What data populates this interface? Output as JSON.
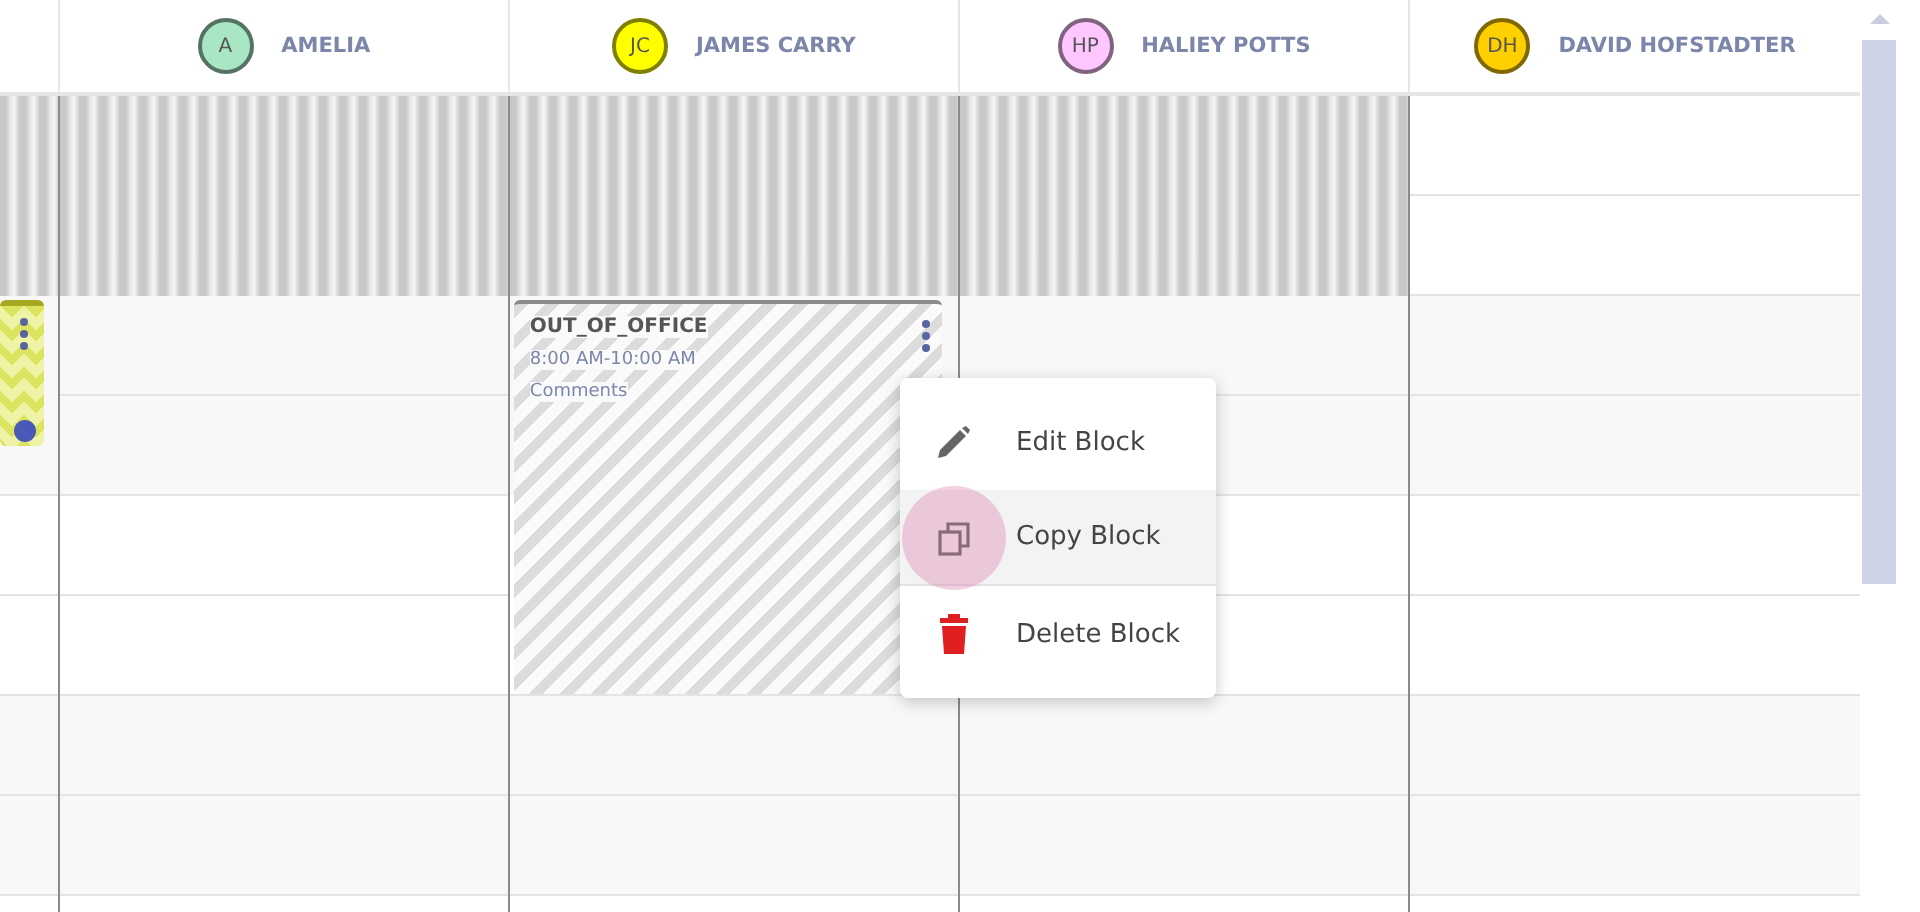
{
  "columns": [
    {
      "unavailable": true,
      "events": [
        {
          "kind": "zigzag"
        }
      ]
    },
    {
      "initials": "A",
      "name": "AMELIA",
      "color": "#a8e6c4",
      "unavailable": true
    },
    {
      "initials": "JC",
      "name": "JAMES CARRY",
      "color": "#ffff00",
      "unavailable": true,
      "events": [
        {
          "kind": "out_of_office",
          "title": "OUT_OF_OFFICE",
          "time": "8:00 AM-10:00 AM",
          "comments": "Comments"
        }
      ]
    },
    {
      "initials": "HP",
      "name": "HALIEY POTTS",
      "color": "#ffc6ff",
      "unavailable": true
    },
    {
      "initials": "DH",
      "name": "DAVID HOFSTADTER",
      "color": "#ffd000",
      "unavailable": false
    }
  ],
  "context_menu": {
    "items": [
      {
        "kind": "edit",
        "label": "Edit Block",
        "selected": false
      },
      {
        "kind": "copy",
        "label": "Copy Block",
        "selected": true
      },
      {
        "kind": "delete",
        "label": "Delete Block",
        "selected": false
      }
    ]
  }
}
